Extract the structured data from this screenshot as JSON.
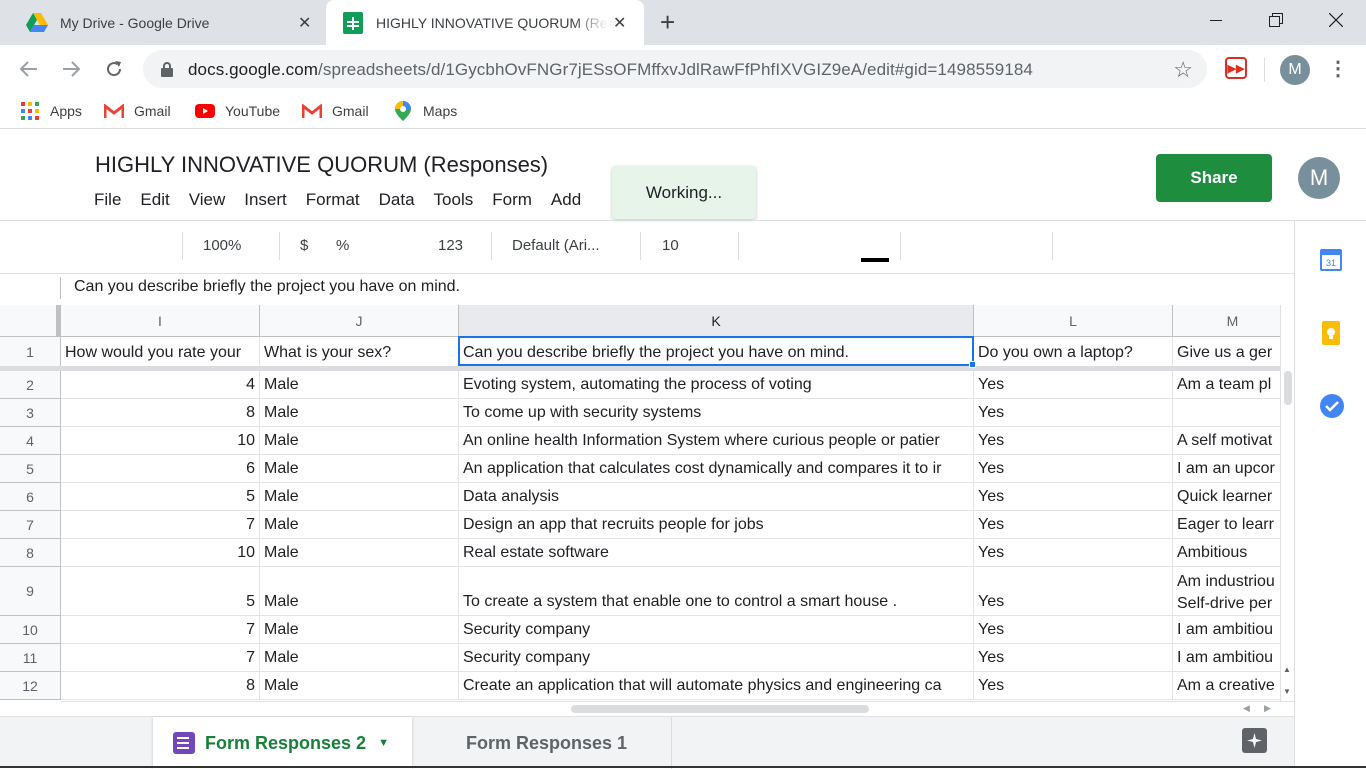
{
  "browser": {
    "tabs": [
      {
        "title": "My Drive - Google Drive",
        "icon": "google-drive-icon",
        "active": false
      },
      {
        "title": "HIGHLY INNOVATIVE QUORUM (Responses)",
        "icon": "google-sheets-icon",
        "active": true
      }
    ],
    "new_tab": "+",
    "url_host": "docs.google.com",
    "url_path": "/spreadsheets/d/1GycbhOvFNGr7jESsOFMffxvJdlRawFfPhfIXVGIZ9eA/edit#gid=1498559184",
    "profile_initial": "M"
  },
  "bookmarks": [
    {
      "label": "Apps",
      "icon": "apps-grid-icon"
    },
    {
      "label": "Gmail",
      "icon": "gmail-icon"
    },
    {
      "label": "YouTube",
      "icon": "youtube-icon"
    },
    {
      "label": "Gmail",
      "icon": "gmail-icon"
    },
    {
      "label": "Maps",
      "icon": "maps-icon"
    }
  ],
  "sheets": {
    "title": "HIGHLY INNOVATIVE QUORUM (Responses)",
    "menu": [
      "File",
      "Edit",
      "View",
      "Insert",
      "Format",
      "Data",
      "Tools",
      "Form",
      "Add"
    ],
    "toast": "Working...",
    "share_label": "Share",
    "avatar_initial": "M",
    "toolbar": {
      "zoom": "100%",
      "currency": "$",
      "percent": "%",
      "format_123": "123",
      "font": "Default (Ari...",
      "font_size": "10"
    },
    "formula": "Can you describe briefly the project you have on mind.",
    "accent": "#1e8e3e",
    "selection_color": "#1a73e8"
  },
  "grid": {
    "columns": [
      "I",
      "J",
      "K",
      "L",
      "M"
    ],
    "row_numbers": [
      "1",
      "2",
      "3",
      "4",
      "5",
      "6",
      "7",
      "8",
      "9",
      "10",
      "11",
      "12"
    ],
    "header_row": [
      "How would you rate your",
      "What is your sex?",
      "Can you describe briefly the project you have on mind.",
      "Do you own a laptop?",
      "Give us a ger"
    ],
    "rows": [
      [
        "4",
        "Male",
        "Evoting system, automating the process of voting",
        "Yes",
        "Am a team pl"
      ],
      [
        "8",
        "Male",
        "To come up with security systems",
        "Yes",
        ""
      ],
      [
        "10",
        "Male",
        "An online health Information System where curious people or patier",
        "Yes",
        "A self motivat"
      ],
      [
        "6",
        "Male",
        "An application that calculates cost dynamically and compares it to ir",
        "Yes",
        "I am an upcor"
      ],
      [
        "5",
        "Male",
        "Data analysis",
        "Yes",
        "Quick learner"
      ],
      [
        "7",
        "Male",
        "Design an app that recruits people for jobs",
        "Yes",
        "Eager to learr"
      ],
      [
        "10",
        "Male",
        "Real estate software",
        "Yes",
        "Ambitious"
      ],
      [
        "5",
        "Male",
        "To create a system that enable one to control a smart house .",
        "Yes",
        "Am industriou\nSelf-drive per"
      ],
      [
        "7",
        "Male",
        "Security company",
        "Yes",
        "I am ambitiou"
      ],
      [
        "7",
        "Male",
        "Security company",
        "Yes",
        "I am ambitiou"
      ],
      [
        "8",
        "Male",
        "Create an application that will automate physics and engineering ca",
        "Yes",
        "Am a creative"
      ]
    ]
  },
  "sheet_tabs": [
    {
      "label": "Form Responses 2",
      "active": true
    },
    {
      "label": "Form Responses 1",
      "active": false
    }
  ]
}
